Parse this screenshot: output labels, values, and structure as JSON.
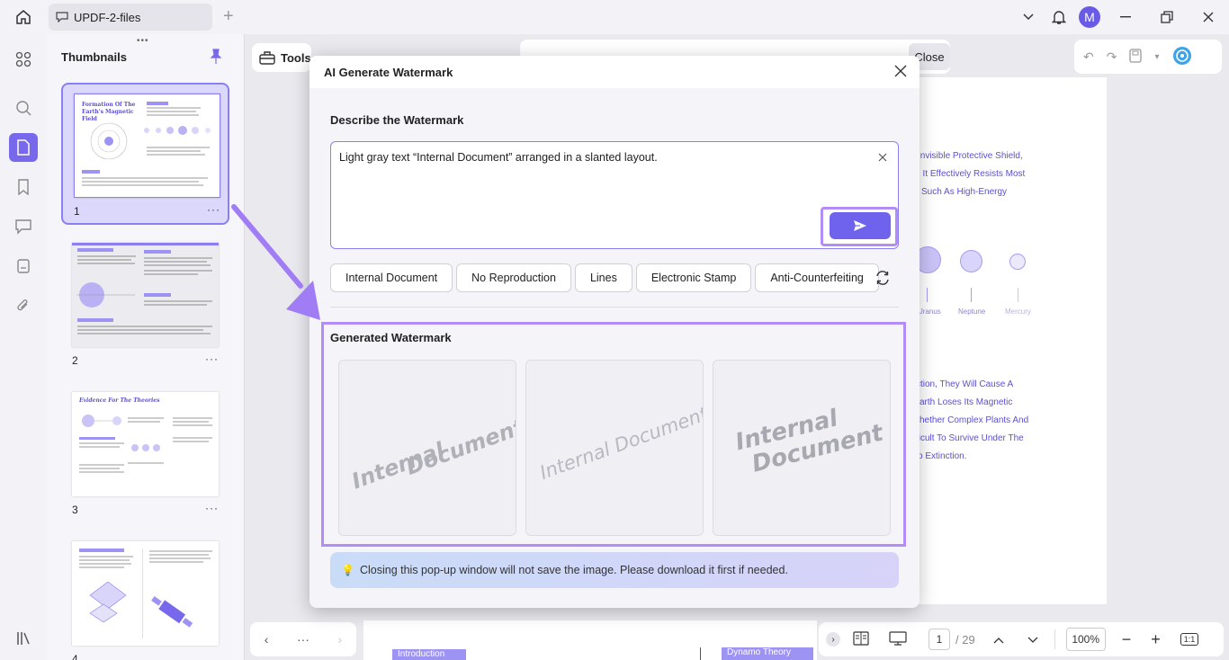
{
  "titlebar": {
    "tab_label": "UPDF-2-files",
    "avatar_letter": "M"
  },
  "thumbnails": {
    "title": "Thumbnails",
    "pages": [
      {
        "number": "1",
        "heading": "Formation Of The Earth's Magnetic Field"
      },
      {
        "number": "2",
        "heading": ""
      },
      {
        "number": "3",
        "heading": "Evidence For The Theories"
      },
      {
        "number": "4",
        "heading": ""
      }
    ],
    "more_label": "···"
  },
  "toolbar": {
    "tools_label": "Tools",
    "close_label": "Close"
  },
  "document": {
    "lines": [
      "Invisible Protective Shield,",
      ", It Effectively Resists Most",
      "Such As High-Energy",
      "ction, They Will Cause A",
      "arth Loses Its Magnetic",
      "hether Complex Plants And",
      "ficult To Survive Under The",
      "o Extinction."
    ],
    "planet_labels": [
      "Uranus",
      "Neptune",
      "Mercury"
    ],
    "tag_intro": "Introduction",
    "tag_dynamo": "Dynamo Theory"
  },
  "bottombar": {
    "current_page": "1",
    "total_pages": "/ 29",
    "zoom": "100%",
    "fit_label": "1:1"
  },
  "modal": {
    "title": "AI Generate Watermark",
    "describe_label": "Describe the Watermark",
    "prompt_value": "Light gray text “Internal Document” arranged in a slanted layout.",
    "chips": [
      "Internal Document",
      "No Reproduction",
      "Lines",
      "Electronic Stamp",
      "Anti-Counterfeiting"
    ],
    "generated_label": "Generated Watermark",
    "watermarks": [
      {
        "word1": "Internal",
        "word2": "Document"
      },
      {
        "word1": "Internal",
        "word2": "Document"
      },
      {
        "word1": "Internal",
        "word2": "Document"
      }
    ],
    "notice": "Closing this pop-up window will not save the image. Please download it first if needed.",
    "notice_icon": "💡"
  },
  "colors": {
    "accent": "#6f63ee",
    "highlight": "#b28cf7",
    "doc_text": "#5b4fd9"
  }
}
